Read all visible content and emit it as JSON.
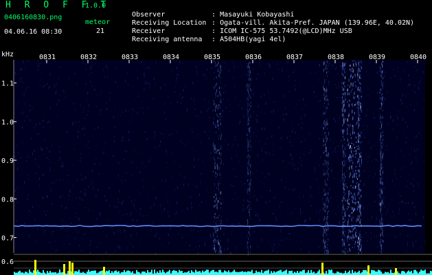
{
  "header": {
    "app_title": "H R O F F T",
    "app_version": "1.0.0",
    "file_name": "0406160830.png",
    "datetime": "04.06.16 08:30",
    "meteor_label": "meteor",
    "meteor_count": "21"
  },
  "info": [
    {
      "key": "Observer",
      "value": ": Masayuki Kobayashi"
    },
    {
      "key": "Receiving Location",
      "value": ": Ogata-vill. Akita-Pref. JAPAN (139.96E, 40.02N)"
    },
    {
      "key": "Receiver",
      "value": ": ICOM IC-575 53.7492(@LCD)MHz USB"
    },
    {
      "key": "Receiving antenna",
      "value": ": A504HB(yagi 4el)"
    }
  ],
  "spectrogram": {
    "unit_label": "kHz",
    "time_ticks": [
      "0831",
      "0832",
      "0833",
      "0834",
      "0835",
      "0836",
      "0837",
      "0838",
      "0839",
      "0840"
    ],
    "freq_ticks": [
      "1.1",
      "1.0",
      "0.9",
      "0.8",
      "0.7"
    ],
    "freq_range": [
      0.66,
      1.16
    ],
    "carrier_freq": 0.73,
    "lower_panel_ticks": [
      "0.6"
    ],
    "colors": {
      "background": "#000020",
      "noise": "#1a2a88",
      "carrier": "#5f8cff",
      "burst": "#cfe0ff",
      "level": "#33ffff",
      "peak": "#ffff00"
    }
  }
}
